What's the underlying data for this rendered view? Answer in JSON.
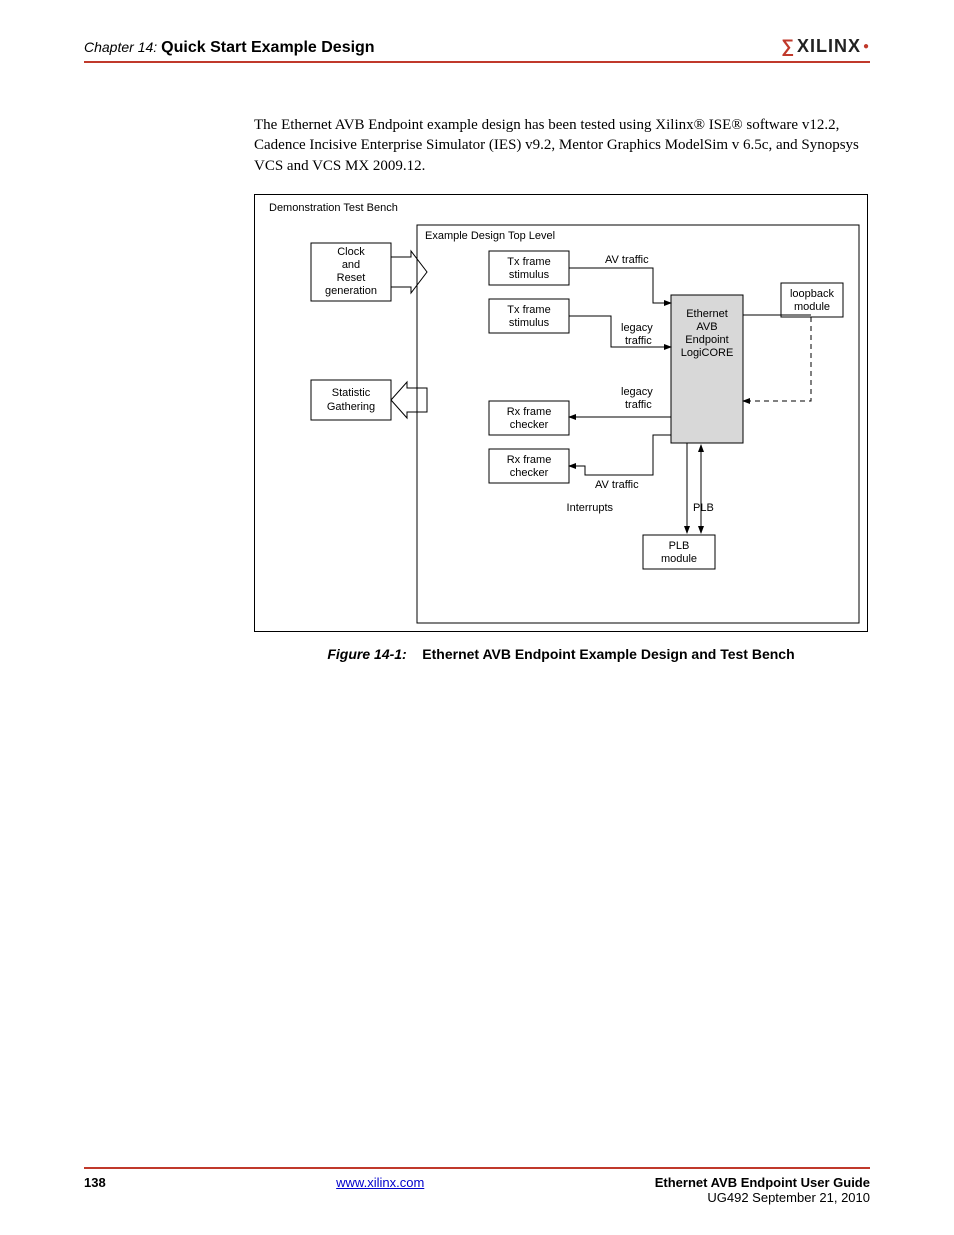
{
  "header": {
    "chapter_prefix": "Chapter 14:",
    "chapter_title": "Quick Start Example Design",
    "logo_text": "XILINX"
  },
  "paragraph": "The Ethernet AVB Endpoint example design has been tested using Xilinx® ISE® software v12.2, Cadence Incisive Enterprise Simulator (IES) v9.2, Mentor Graphics ModelSim v 6.5c, and Synopsys VCS and VCS MX 2009.12.",
  "figure": {
    "outer_label": "Demonstration  Test Bench",
    "inner_label": "Example Design Top Level",
    "clock_box": {
      "l1": "Clock",
      "l2": "and",
      "l3": "Reset",
      "l4": "generation"
    },
    "stat_box": {
      "l1": "Statistic",
      "l2": "Gathering"
    },
    "tx1": {
      "l1": "Tx frame",
      "l2": "stimulus"
    },
    "tx2": {
      "l1": "Tx frame",
      "l2": "stimulus"
    },
    "rx1": {
      "l1": "Rx frame",
      "l2": "checker"
    },
    "rx2": {
      "l1": "Rx frame",
      "l2": "checker"
    },
    "core": {
      "l1": "Ethernet",
      "l2": "AVB",
      "l3": "Endpoint",
      "l4": "LogiCORE"
    },
    "loopback": {
      "l1": "loopback",
      "l2": "module"
    },
    "plb": {
      "l1": "PLB",
      "l2": "module"
    },
    "labels": {
      "av1": "AV traffic",
      "legacy1": "legacy",
      "legacy1b": "traffic",
      "legacy2": "legacy",
      "legacy2b": "traffic",
      "av2": "AV traffic",
      "interrupts": "Interrupts",
      "plb": "PLB"
    },
    "caption_num": "Figure 14-1:",
    "caption_title": "Ethernet AVB Endpoint Example Design and Test Bench"
  },
  "footer": {
    "page_num": "138",
    "link": "www.xilinx.com",
    "line1": "Ethernet AVB Endpoint User Guide",
    "line2": "UG492 September 21, 2010"
  }
}
